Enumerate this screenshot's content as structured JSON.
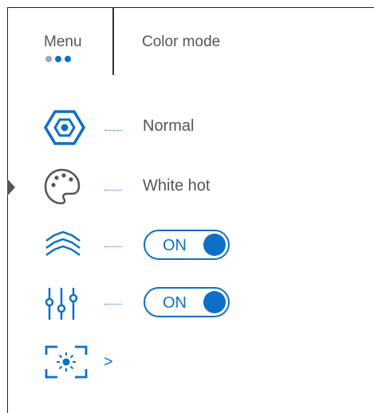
{
  "header": {
    "menu_label": "Menu",
    "title": "Color mode",
    "page_dots": [
      "inactive",
      "active",
      "active"
    ]
  },
  "colors": {
    "accent": "#0e6fc6",
    "text": "#555555",
    "dot_inactive": "#a6a6a6"
  },
  "rows": [
    {
      "icon": "color-mode-hexagon-icon",
      "value": "Normal"
    },
    {
      "icon": "palette-icon",
      "value": "White hot"
    },
    {
      "icon": "waves-icon",
      "toggle": "ON"
    },
    {
      "icon": "sliders-icon",
      "toggle": "ON"
    },
    {
      "icon": "brightness-frame-icon",
      "chevron": ">"
    }
  ]
}
